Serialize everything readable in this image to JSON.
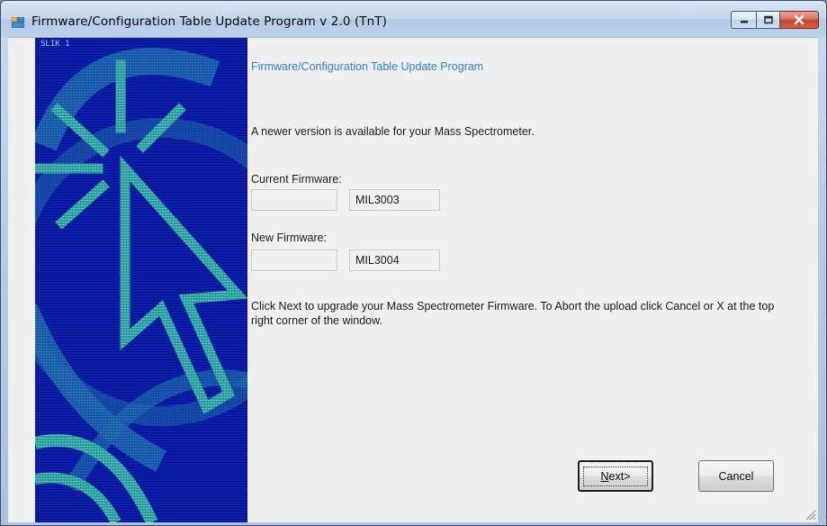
{
  "window": {
    "title": "Firmware/Configuration Table Update Program v 2.0 (TnT)",
    "icon": "app-window-icon",
    "caption_buttons": [
      "minimize-icon",
      "maximize-icon",
      "close-icon"
    ]
  },
  "banner": {
    "label": "SLIK 1",
    "image": "cursor-arrow-burst-graphic"
  },
  "content": {
    "heading": "Firmware/Configuration Table Update Program",
    "message": "A newer version is available for your Mass Spectrometer.",
    "current_firmware": {
      "label": "Current  Firmware:",
      "prefix": "",
      "value": "MIL3003"
    },
    "new_firmware": {
      "label": "New Firmware:",
      "prefix": "",
      "value": "MIL3004"
    },
    "instructions": "Click Next to upgrade your Mass Spectrometer Firmware. To Abort the upload click Cancel or X at the top right corner of the window."
  },
  "buttons": {
    "next_label": "Next>",
    "next_mnemonic": "N",
    "next_rest": "ext>",
    "cancel_label": "Cancel"
  },
  "colors": {
    "heading": "#2d7fe0",
    "banner_blue": "#0b1fb8",
    "banner_accent": "#3ec5c0"
  }
}
